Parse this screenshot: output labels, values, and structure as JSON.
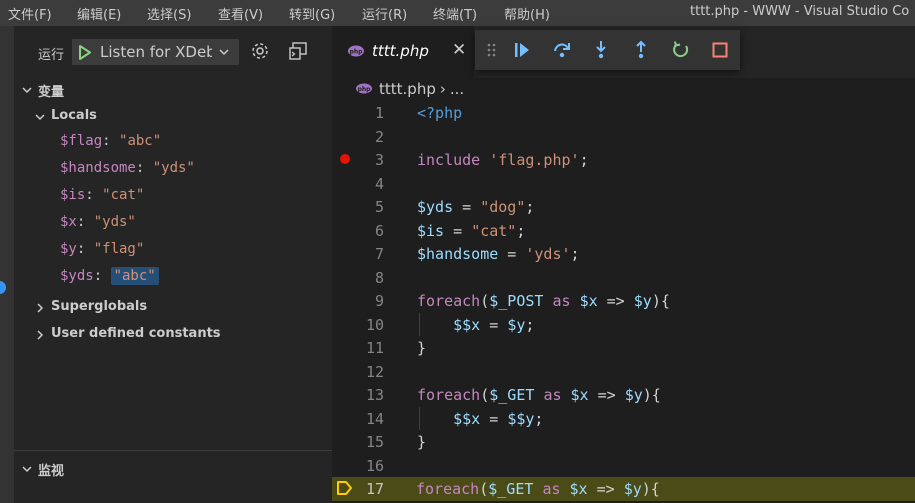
{
  "menubar": {
    "items": [
      "文件(F)",
      "编辑(E)",
      "选择(S)",
      "查看(V)",
      "转到(G)",
      "运行(R)",
      "终端(T)",
      "帮助(H)"
    ],
    "window_title": "tttt.php - WWW - Visual Studio Co"
  },
  "debug_panel": {
    "run_label": "运行",
    "config_name": "Listen for XDebug",
    "variables_header": "变量",
    "locals_header": "Locals",
    "locals": [
      {
        "name": "$flag",
        "value": "\"abc\""
      },
      {
        "name": "$handsome",
        "value": "\"yds\""
      },
      {
        "name": "$is",
        "value": "\"cat\""
      },
      {
        "name": "$x",
        "value": "\"yds\""
      },
      {
        "name": "$y",
        "value": "\"flag\""
      },
      {
        "name": "$yds",
        "value": "\"abc\""
      }
    ],
    "superglobals_header": "Superglobals",
    "constants_header": "User defined constants",
    "watch_header": "监视"
  },
  "editor": {
    "tab_name": "tttt.php",
    "breadcrumb_file": "tttt.php",
    "breadcrumb_more": "...",
    "breakpoint_line": 3,
    "current_line": 17,
    "lines": [
      {
        "num": "1",
        "text": "<?php"
      },
      {
        "num": "2",
        "text": ""
      },
      {
        "num": "3",
        "text": "include 'flag.php';"
      },
      {
        "num": "4",
        "text": ""
      },
      {
        "num": "5",
        "text": "$yds = \"dog\";"
      },
      {
        "num": "6",
        "text": "$is = \"cat\";"
      },
      {
        "num": "7",
        "text": "$handsome = 'yds';"
      },
      {
        "num": "8",
        "text": ""
      },
      {
        "num": "9",
        "text": "foreach($_POST as $x => $y){"
      },
      {
        "num": "10",
        "text": "    $$x = $y;"
      },
      {
        "num": "11",
        "text": "}"
      },
      {
        "num": "12",
        "text": ""
      },
      {
        "num": "13",
        "text": "foreach($_GET as $x => $y){"
      },
      {
        "num": "14",
        "text": "    $$x = $$y;"
      },
      {
        "num": "15",
        "text": "}"
      },
      {
        "num": "16",
        "text": ""
      },
      {
        "num": "17",
        "text": "foreach($_GET as $x => $y){"
      }
    ]
  },
  "debug_toolbar": {
    "buttons": [
      "drag-handle-icon",
      "continue-icon",
      "step-over-icon",
      "step-into-icon",
      "step-out-icon",
      "restart-icon",
      "stop-icon"
    ]
  },
  "colors": {
    "accent": "#3794ff",
    "breakpoint": "#e51400",
    "current_line_bg": "#4b4b18",
    "continue": "#75beff",
    "restart": "#89d185",
    "stop": "#f48771",
    "php_icon": "#a074c4"
  }
}
